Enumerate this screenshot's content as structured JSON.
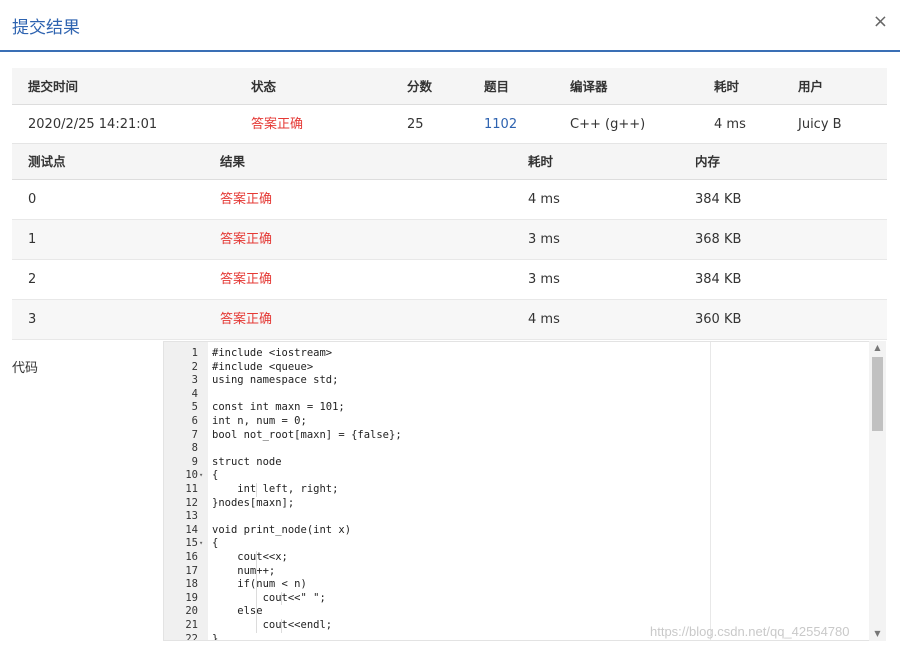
{
  "modal": {
    "title": "提交结果",
    "close_glyph": "×"
  },
  "summary": {
    "headers": [
      "提交时间",
      "状态",
      "分数",
      "题目",
      "编译器",
      "耗时",
      "用户"
    ],
    "row": {
      "time": "2020/2/25 14:21:01",
      "status": "答案正确",
      "score": "25",
      "problem": "1102",
      "compiler": "C++ (g++)",
      "runtime": "4 ms",
      "user": "Juicy B"
    }
  },
  "tests": {
    "headers": [
      "测试点",
      "结果",
      "耗时",
      "内存"
    ],
    "rows": [
      {
        "id": "0",
        "result": "答案正确",
        "time": "4 ms",
        "memory": "384 KB"
      },
      {
        "id": "1",
        "result": "答案正确",
        "time": "3 ms",
        "memory": "368 KB"
      },
      {
        "id": "2",
        "result": "答案正确",
        "time": "3 ms",
        "memory": "384 KB"
      },
      {
        "id": "3",
        "result": "答案正确",
        "time": "4 ms",
        "memory": "360 KB"
      }
    ]
  },
  "code": {
    "label": "代码",
    "lines": [
      {
        "n": "1",
        "fold": "",
        "text": "#include <iostream>"
      },
      {
        "n": "2",
        "fold": "",
        "text": "#include <queue>"
      },
      {
        "n": "3",
        "fold": "",
        "text": "using namespace std;"
      },
      {
        "n": "4",
        "fold": "",
        "text": ""
      },
      {
        "n": "5",
        "fold": "",
        "text": "const int maxn = 101;"
      },
      {
        "n": "6",
        "fold": "",
        "text": "int n, num = 0;"
      },
      {
        "n": "7",
        "fold": "",
        "text": "bool not_root[maxn] = {false};"
      },
      {
        "n": "8",
        "fold": "",
        "text": ""
      },
      {
        "n": "9",
        "fold": "",
        "text": "struct node"
      },
      {
        "n": "10",
        "fold": "▾",
        "text": "{"
      },
      {
        "n": "11",
        "fold": "",
        "text": "    int left, right;"
      },
      {
        "n": "12",
        "fold": "",
        "text": "}nodes[maxn];"
      },
      {
        "n": "13",
        "fold": "",
        "text": ""
      },
      {
        "n": "14",
        "fold": "",
        "text": "void print_node(int x)"
      },
      {
        "n": "15",
        "fold": "▾",
        "text": "{"
      },
      {
        "n": "16",
        "fold": "",
        "text": "    cout<<x;"
      },
      {
        "n": "17",
        "fold": "",
        "text": "    num++;"
      },
      {
        "n": "18",
        "fold": "",
        "text": "    if(num < n)"
      },
      {
        "n": "19",
        "fold": "",
        "text": "        cout<<\" \";"
      },
      {
        "n": "20",
        "fold": "",
        "text": "    else"
      },
      {
        "n": "21",
        "fold": "",
        "text": "        cout<<endl;"
      },
      {
        "n": "22",
        "fold": "",
        "text": "}"
      }
    ]
  },
  "scrollbar": {
    "up_glyph": "▲",
    "down_glyph": "▼"
  },
  "watermark": "https://blog.csdn.net/qq_42554780",
  "colors": {
    "accent": "#2e63b0",
    "accepted": "#e53935",
    "header_bg": "#f5f5f5"
  }
}
